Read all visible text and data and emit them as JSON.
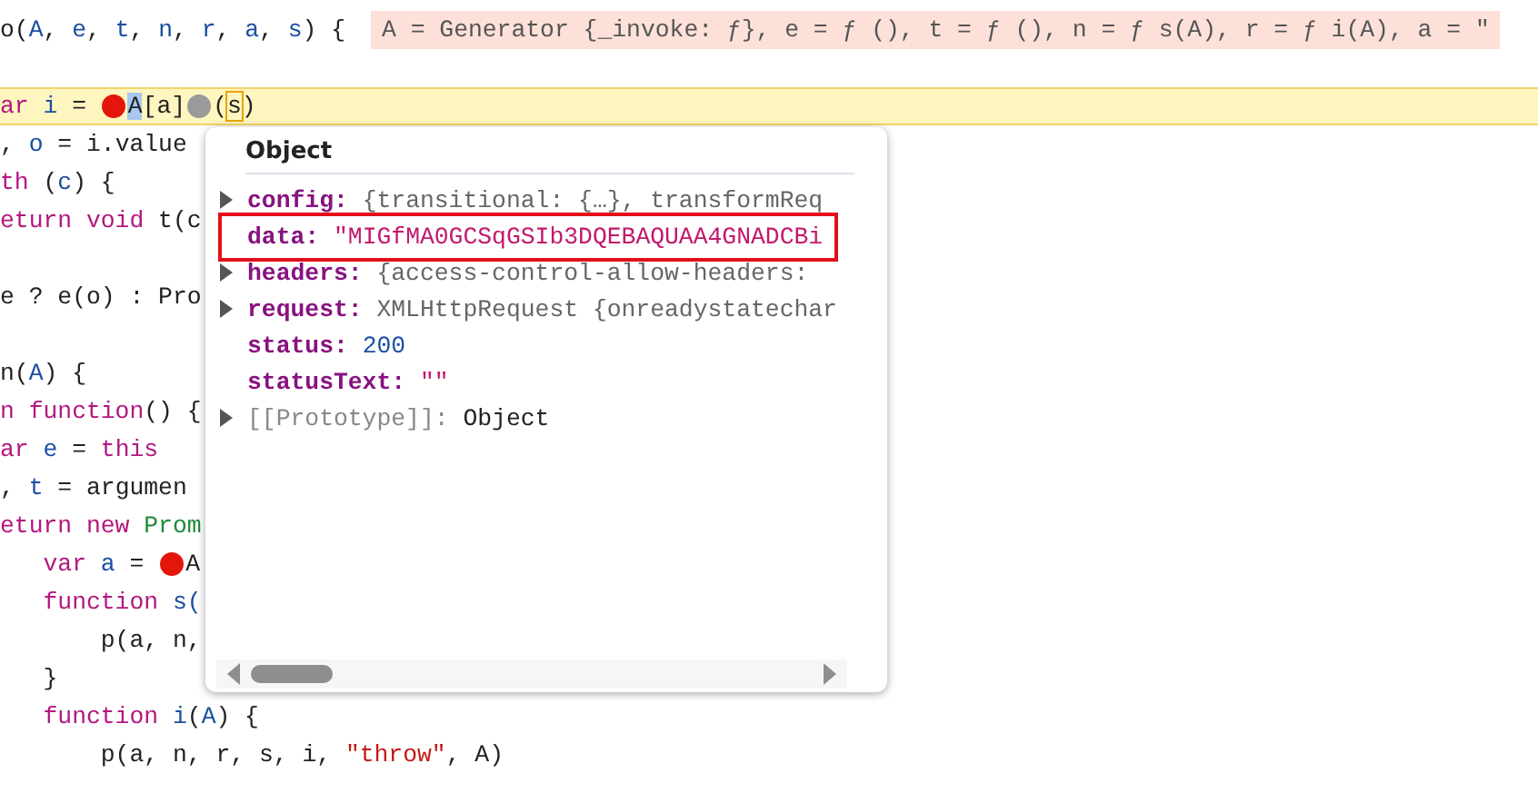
{
  "code_lines": [
    {
      "blank_line_after": true,
      "tokens": [
        {
          "text": "o(",
          "kind": "plain"
        },
        {
          "text": "A",
          "kind": "var"
        },
        {
          "text": ", ",
          "kind": "plain"
        },
        {
          "text": "e",
          "kind": "var"
        },
        {
          "text": ", ",
          "kind": "plain"
        },
        {
          "text": "t",
          "kind": "var"
        },
        {
          "text": ", ",
          "kind": "plain"
        },
        {
          "text": "n",
          "kind": "var"
        },
        {
          "text": ", ",
          "kind": "plain"
        },
        {
          "text": "r",
          "kind": "var"
        },
        {
          "text": ", ",
          "kind": "plain"
        },
        {
          "text": "a",
          "kind": "var"
        },
        {
          "text": ", ",
          "kind": "plain"
        },
        {
          "text": "s",
          "kind": "var"
        },
        {
          "text": ") {",
          "kind": "plain"
        },
        {
          "text": "A = Generator {_invoke: ƒ}, e = ƒ (), t = ƒ (), n = ƒ s(A), r = ƒ i(A), a = \"",
          "kind": "inline-value"
        }
      ]
    },
    {
      "paused": true,
      "tokens": [
        {
          "text": "ar",
          "kind": "keyword"
        },
        {
          "text": " i",
          "kind": "var"
        },
        {
          "text": " = ",
          "kind": "plain"
        },
        {
          "kind": "breakpoint",
          "active": true
        },
        {
          "text": "A",
          "kind": "selected"
        },
        {
          "text": "[a]",
          "kind": "plain"
        },
        {
          "kind": "breakpoint",
          "active": false
        },
        {
          "text": "(",
          "kind": "plain"
        },
        {
          "text": "s",
          "kind": "boxed"
        },
        {
          "text": ")",
          "kind": "plain"
        }
      ]
    },
    {
      "tokens": [
        {
          "text": ", ",
          "kind": "plain"
        },
        {
          "text": "o",
          "kind": "var"
        },
        {
          "text": " = i.value",
          "kind": "plain"
        }
      ]
    },
    {
      "tokens": [
        {
          "text": "th",
          "kind": "keyword"
        },
        {
          "text": " (",
          "kind": "plain"
        },
        {
          "text": "c",
          "kind": "var"
        },
        {
          "text": ") {",
          "kind": "plain"
        }
      ]
    },
    {
      "blank_line_after": true,
      "tokens": [
        {
          "text": "eturn void",
          "kind": "keyword"
        },
        {
          "text": " t(c",
          "kind": "plain"
        }
      ]
    },
    {
      "blank_line_after": true,
      "tokens": [
        {
          "text": "e ? e(o) : Pro",
          "kind": "plain"
        }
      ]
    },
    {
      "tokens": [
        {
          "text": "n(",
          "kind": "plain"
        },
        {
          "text": "A",
          "kind": "var"
        },
        {
          "text": ") {",
          "kind": "plain"
        }
      ]
    },
    {
      "tokens": [
        {
          "text": "n function",
          "kind": "keyword"
        },
        {
          "text": "() {",
          "kind": "plain"
        }
      ]
    },
    {
      "tokens": [
        {
          "text": "ar",
          "kind": "keyword"
        },
        {
          "text": " e",
          "kind": "var"
        },
        {
          "text": " = ",
          "kind": "plain"
        },
        {
          "text": "this",
          "kind": "keyword"
        }
      ]
    },
    {
      "tokens": [
        {
          "text": ", ",
          "kind": "plain"
        },
        {
          "text": "t",
          "kind": "var"
        },
        {
          "text": " = argumen",
          "kind": "plain"
        }
      ]
    },
    {
      "tokens": [
        {
          "text": "eturn new",
          "kind": "keyword"
        },
        {
          "text": " Prom",
          "kind": "class"
        }
      ]
    },
    {
      "tokens": [
        {
          "text": "   var",
          "kind": "keyword"
        },
        {
          "text": " a",
          "kind": "var"
        },
        {
          "text": " = ",
          "kind": "plain"
        },
        {
          "kind": "breakpoint",
          "active": true
        },
        {
          "text": "A",
          "kind": "plain"
        }
      ]
    },
    {
      "tokens": [
        {
          "text": "   function",
          "kind": "keyword"
        },
        {
          "text": " s(",
          "kind": "var"
        }
      ]
    },
    {
      "tokens": [
        {
          "text": "       p(a, n,",
          "kind": "plain"
        }
      ]
    },
    {
      "tokens": [
        {
          "text": "   }",
          "kind": "plain"
        }
      ]
    },
    {
      "tokens": [
        {
          "text": "   function",
          "kind": "keyword"
        },
        {
          "text": " i",
          "kind": "var"
        },
        {
          "text": "(",
          "kind": "plain"
        },
        {
          "text": "A",
          "kind": "var"
        },
        {
          "text": ") {",
          "kind": "plain"
        }
      ]
    },
    {
      "tokens": [
        {
          "text": "       p(a, n, r, s, i, ",
          "kind": "plain"
        },
        {
          "text": "\"throw\"",
          "kind": "string"
        },
        {
          "text": ", A)",
          "kind": "plain"
        }
      ]
    }
  ],
  "popup": {
    "title": "Object",
    "properties": [
      {
        "name": "config:",
        "value": "{transitional: {…}, transformReq",
        "kind": "preview",
        "expandable": true,
        "highlighted": false,
        "dimmed": false
      },
      {
        "name": "data:",
        "value": "\"MIGfMA0GCSqGSIb3DQEBAQUAA4GNADCBi",
        "kind": "string",
        "expandable": false,
        "highlighted": true,
        "dimmed": false
      },
      {
        "name": "headers:",
        "value": "{access-control-allow-headers:",
        "kind": "preview",
        "expandable": true,
        "highlighted": false,
        "dimmed": false
      },
      {
        "name": "request:",
        "value": "XMLHttpRequest {onreadystatechar",
        "kind": "preview",
        "expandable": true,
        "highlighted": false,
        "dimmed": false
      },
      {
        "name": "status:",
        "value": "200",
        "kind": "number",
        "expandable": false,
        "highlighted": false,
        "dimmed": false
      },
      {
        "name": "statusText:",
        "value": "\"\"",
        "kind": "string",
        "expandable": false,
        "highlighted": false,
        "dimmed": false
      },
      {
        "name": "[[Prototype]]:",
        "value": "Object",
        "kind": "plain",
        "expandable": true,
        "highlighted": false,
        "dimmed": true
      }
    ]
  }
}
